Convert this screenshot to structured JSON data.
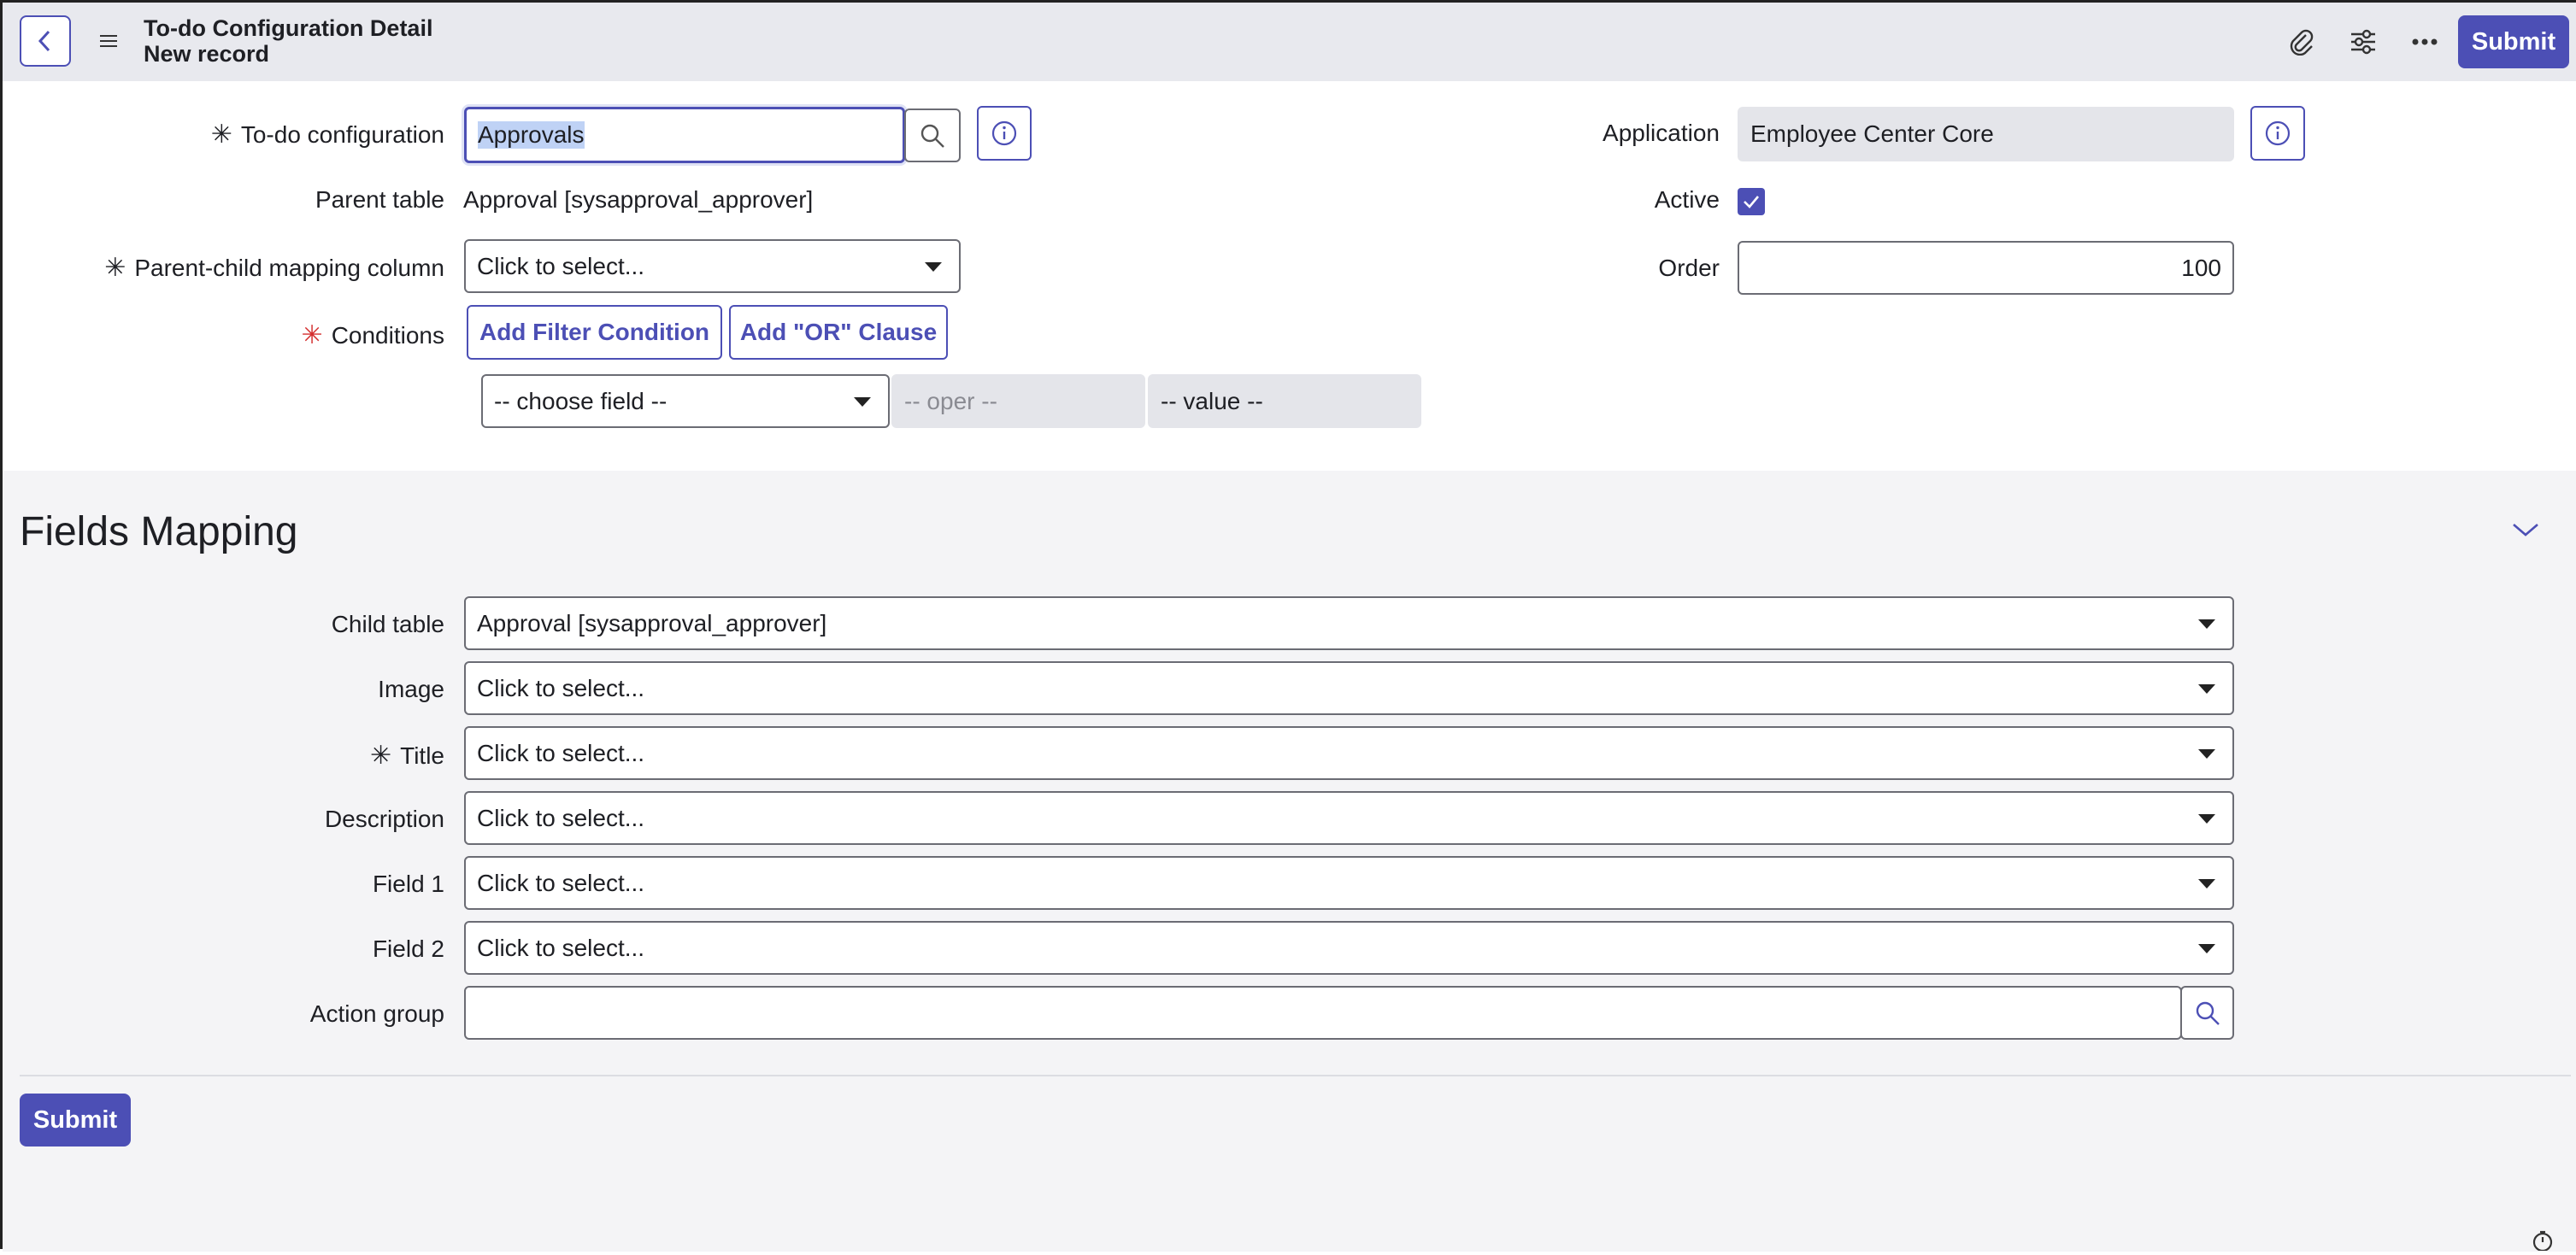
{
  "header": {
    "title": "To-do Configuration Detail",
    "subtitle": "New record",
    "submit_label": "Submit"
  },
  "form": {
    "todo_configuration": {
      "label": "To-do configuration",
      "value": "Approvals"
    },
    "parent_table": {
      "label": "Parent table",
      "value": "Approval [sysapproval_approver]"
    },
    "mapping_column": {
      "label": "Parent-child mapping column",
      "value": "Click to select..."
    },
    "conditions": {
      "label": "Conditions",
      "add_filter_label": "Add Filter Condition",
      "add_or_label": "Add \"OR\" Clause",
      "choose_field": "-- choose field --",
      "oper": "-- oper --",
      "value": "-- value --"
    },
    "application": {
      "label": "Application",
      "value": "Employee Center Core"
    },
    "active": {
      "label": "Active",
      "checked": true
    },
    "order": {
      "label": "Order",
      "value": "100"
    }
  },
  "fields_mapping": {
    "title": "Fields Mapping",
    "child_table": {
      "label": "Child table",
      "value": "Approval [sysapproval_approver]"
    },
    "image": {
      "label": "Image",
      "value": "Click to select..."
    },
    "title_field": {
      "label": "Title",
      "value": "Click to select..."
    },
    "description": {
      "label": "Description",
      "value": "Click to select..."
    },
    "field1": {
      "label": "Field 1",
      "value": "Click to select..."
    },
    "field2": {
      "label": "Field 2",
      "value": "Click to select..."
    },
    "action_group": {
      "label": "Action group",
      "value": ""
    }
  },
  "footer": {
    "submit_label": "Submit"
  },
  "colors": {
    "accent": "#4c4fb5",
    "required": "#d43030",
    "header_bg": "#e8e9ee"
  }
}
